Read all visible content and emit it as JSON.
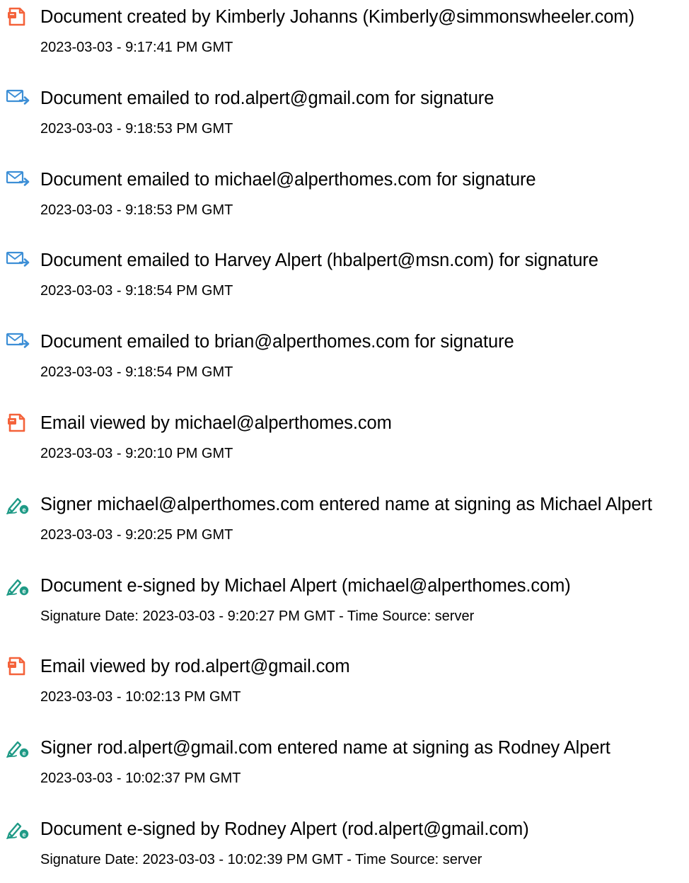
{
  "colors": {
    "document_icon": "#f4623a",
    "email_icon": "#3d8fd6",
    "signature_icon": "#1f9a86"
  },
  "events": [
    {
      "icon": "document-icon",
      "title": "Document created by Kimberly Johanns (Kimberly@simmonswheeler.com)",
      "timestamp": "2023-03-03 - 9:17:41 PM GMT"
    },
    {
      "icon": "email-sent-icon",
      "title": "Document emailed to rod.alpert@gmail.com for signature",
      "timestamp": "2023-03-03 - 9:18:53 PM GMT"
    },
    {
      "icon": "email-sent-icon",
      "title": "Document emailed to michael@alperthomes.com for signature",
      "timestamp": "2023-03-03 - 9:18:53 PM GMT"
    },
    {
      "icon": "email-sent-icon",
      "title": "Document emailed to Harvey Alpert (hbalpert@msn.com) for signature",
      "timestamp": "2023-03-03 - 9:18:54 PM GMT"
    },
    {
      "icon": "email-sent-icon",
      "title": "Document emailed to brian@alperthomes.com for signature",
      "timestamp": "2023-03-03 - 9:18:54 PM GMT"
    },
    {
      "icon": "document-icon",
      "title": "Email viewed by michael@alperthomes.com",
      "timestamp": "2023-03-03 - 9:20:10 PM GMT"
    },
    {
      "icon": "esign-pen-icon",
      "title": "Signer michael@alperthomes.com entered name at signing as Michael Alpert",
      "timestamp": "2023-03-03 - 9:20:25 PM GMT"
    },
    {
      "icon": "esign-pen-icon",
      "title": "Document e-signed by Michael Alpert (michael@alperthomes.com)",
      "timestamp": "Signature Date: 2023-03-03 - 9:20:27 PM GMT - Time Source: server"
    },
    {
      "icon": "document-icon",
      "title": "Email viewed by rod.alpert@gmail.com",
      "timestamp": "2023-03-03 - 10:02:13 PM GMT"
    },
    {
      "icon": "esign-pen-icon",
      "title": "Signer rod.alpert@gmail.com entered name at signing as Rodney Alpert",
      "timestamp": "2023-03-03 - 10:02:37 PM GMT"
    },
    {
      "icon": "esign-pen-icon",
      "title": "Document e-signed by Rodney Alpert (rod.alpert@gmail.com)",
      "timestamp": "Signature Date: 2023-03-03 - 10:02:39 PM GMT - Time Source: server"
    }
  ]
}
